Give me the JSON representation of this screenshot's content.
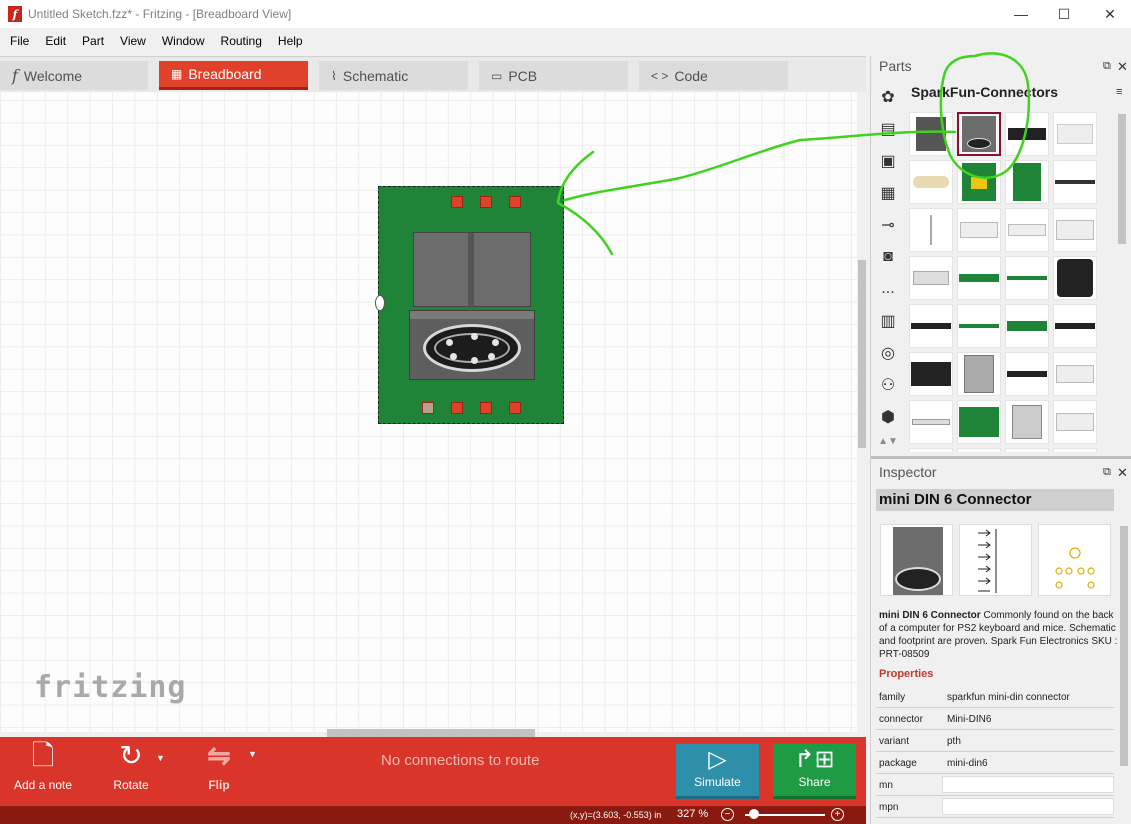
{
  "window": {
    "title": "Untitled Sketch.fzz* - Fritzing - [Breadboard View]",
    "app_icon": "f",
    "controls": {
      "minimize": "—",
      "maximize": "☐",
      "close": "✕"
    }
  },
  "menu": [
    "File",
    "Edit",
    "Part",
    "View",
    "Window",
    "Routing",
    "Help"
  ],
  "tabs": [
    {
      "label": "Welcome",
      "icon": "f",
      "active": false
    },
    {
      "label": "Breadboard",
      "icon": "▦",
      "active": true
    },
    {
      "label": "Schematic",
      "icon": "⌇",
      "active": false
    },
    {
      "label": "PCB",
      "icon": "▭",
      "active": false
    },
    {
      "label": "Code",
      "icon": "< >",
      "active": false
    }
  ],
  "canvas": {
    "logo": "fritzing",
    "part_name": "mini DIN 6 Connector"
  },
  "toolbar": {
    "add_note": "Add a note",
    "rotate": "Rotate",
    "flip": "Flip",
    "route_message": "No connections to route",
    "simulate": "Simulate",
    "share": "Share"
  },
  "status": {
    "coords": "(x,y)=(3.603, -0.553) in",
    "zoom": "327 %",
    "zoom_minus": "−",
    "zoom_plus": "+"
  },
  "parts": {
    "title": "Parts",
    "bin_title": "SparkFun-Connectors",
    "bins": [
      "flower-icon",
      "chip-icon",
      "connector-icon",
      "ic-icon",
      "resistor-icon",
      "button-icon",
      "more-icon",
      "microcontroller-icon",
      "antenna-icon",
      "battery-icon",
      "hexagon-icon",
      "arrows-icon"
    ],
    "more_label": "..."
  },
  "inspector": {
    "title": "Inspector",
    "part_title": "mini DIN 6 Connector",
    "description_name": "mini DIN 6 Connector",
    "description": "Commonly found on the back of a computer for PS2 keyboard and mice. Schematic and footprint are proven. Spark Fun Electronics SKU : PRT-08509",
    "properties_label": "Properties",
    "properties": [
      {
        "key": "family",
        "value": "sparkfun mini-din connector"
      },
      {
        "key": "connector",
        "value": "Mini-DIN6"
      },
      {
        "key": "variant",
        "value": "pth"
      },
      {
        "key": "package",
        "value": "mini-din6"
      },
      {
        "key": "mn",
        "value": ""
      },
      {
        "key": "mpn",
        "value": ""
      }
    ]
  },
  "colors": {
    "accent_red": "#d9352a",
    "simulate_blue": "#2e8fab",
    "share_green": "#1e9b44",
    "pcb_green": "#1f8438",
    "annotation_green": "#3fd21e"
  }
}
